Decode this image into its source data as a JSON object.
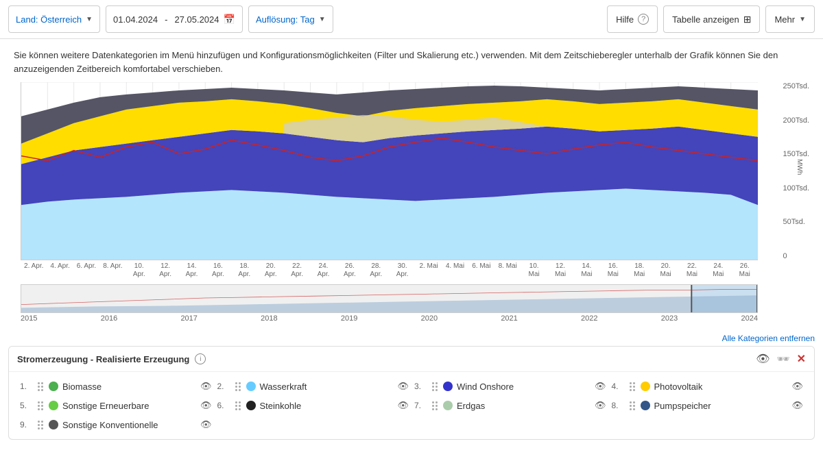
{
  "toolbar": {
    "country_label": "Land: Österreich",
    "date_start": "01.04.2024",
    "date_sep": "-",
    "date_end": "27.05.2024",
    "resolution_label": "Auflösung: Tag",
    "help_label": "Hilfe",
    "table_label": "Tabelle anzeigen",
    "more_label": "Mehr"
  },
  "info_text": "Sie können weitere Datenkategorien im Menü hinzufügen und Konfigurationsmöglichkeiten (Filter und Skalierung etc.) verwenden. Mit dem Zeitschieberegler unterhalb der Grafik können Sie den anzuzeigenden Zeitbereich komfortabel verschieben.",
  "chart": {
    "y_axis": {
      "labels": [
        "250Tsd.",
        "200Tsd.",
        "150Tsd.",
        "100Tsd.",
        "50Tsd.",
        "0"
      ],
      "unit": "MWh"
    },
    "x_axis_labels": [
      "2. Apr.",
      "4. Apr.",
      "6. Apr.",
      "8. Apr.",
      "10.\nApr.",
      "12.\nApr.",
      "14.\nApr.",
      "16.\nApr.",
      "18.\nApr.",
      "20.\nApr.",
      "22.\nApr.",
      "24.\nApr.",
      "26.\nApr.",
      "28.\nApr.",
      "30.\nApr.",
      "2. Mai",
      "4. Mai",
      "6. Mai",
      "8. Mai",
      "10.\nMai",
      "12.\nMai",
      "14.\nMai",
      "16.\nMai",
      "18.\nMai",
      "20.\nMai",
      "22.\nMai",
      "24.\nMai",
      "26.\nMai"
    ]
  },
  "timeline": {
    "labels": [
      "2015",
      "2016",
      "2017",
      "2018",
      "2019",
      "2020",
      "2021",
      "2022",
      "2023",
      "2024"
    ]
  },
  "legend": {
    "title": "Stromerzeugung - Realisierte Erzeugung",
    "remove_all": "Alle Kategorien entfernen",
    "items": [
      {
        "num": "1.",
        "name": "Biomasse",
        "color": "#4caf50"
      },
      {
        "num": "2.",
        "name": "Wasserkraft",
        "color": "#66ccff"
      },
      {
        "num": "3.",
        "name": "Wind Onshore",
        "color": "#3333cc"
      },
      {
        "num": "4.",
        "name": "Photovoltaik",
        "color": "#ffcc00"
      },
      {
        "num": "5.",
        "name": "Sonstige Erneuerbare",
        "color": "#66cc44"
      },
      {
        "num": "6.",
        "name": "Steinkohle",
        "color": "#222222"
      },
      {
        "num": "7.",
        "name": "Erdgas",
        "color": "#aaccaa"
      },
      {
        "num": "8.",
        "name": "Pumpspeicher",
        "color": "#335588"
      },
      {
        "num": "9.",
        "name": "Sonstige Konventionelle",
        "color": "#555555"
      }
    ]
  }
}
